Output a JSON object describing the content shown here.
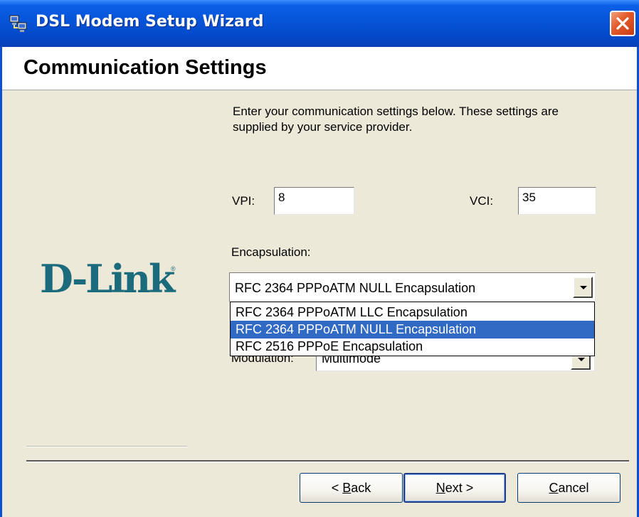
{
  "window": {
    "title": "DSL Modem Setup Wizard",
    "close_label": "Close",
    "accent_color": "#0754d8",
    "close_color": "#e45d2e"
  },
  "header": {
    "title": "Communication Settings"
  },
  "main": {
    "intro_text": "Enter your communication settings below.  These settings are supplied by your service provider.",
    "vpi_label": "VPI:",
    "vpi_value": "8",
    "vci_label": "VCI:",
    "vci_value": "35",
    "encapsulation_label": "Encapsulation:",
    "encapsulation_selected": "RFC 2364 PPPoATM NULL Encapsulation",
    "encapsulation_options": [
      "RFC 2364 PPPoATM LLC Encapsulation",
      "RFC 2364 PPPoATM NULL Encapsulation",
      "RFC 2516 PPPoE Encapsulation"
    ],
    "modulation_label": "Modulation:",
    "modulation_value": "Multimode",
    "selection_color": "#316ac5"
  },
  "logo": {
    "text": "D-Link",
    "registered_mark": "®",
    "color": "#1b6b7d"
  },
  "buttons": {
    "back_prefix": "< ",
    "back_mnemonic": "B",
    "back_rest": "ack",
    "next_mnemonic": "N",
    "next_rest": "ext >",
    "cancel_mnemonic": "C",
    "cancel_rest": "ancel"
  },
  "icons": {
    "app": "network-computers-icon",
    "close": "close-icon",
    "dropdown": "chevron-down-icon"
  }
}
